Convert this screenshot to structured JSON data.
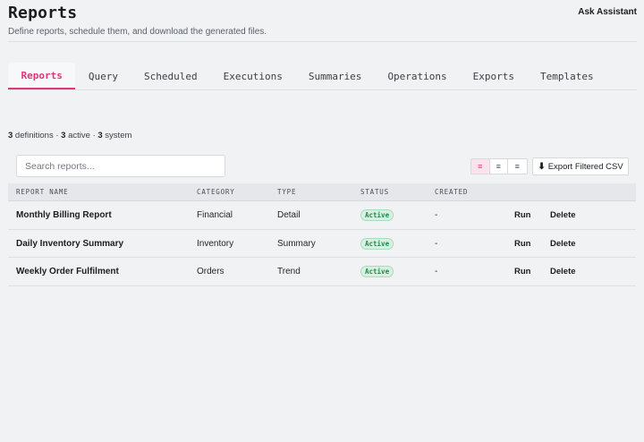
{
  "header": {
    "title": "Reports",
    "subtitle": "Define reports, schedule them, and download the generated files.",
    "assistant_label": "Ask Assistant"
  },
  "tabs": [
    {
      "label": "Reports",
      "active": true
    },
    {
      "label": "Query",
      "active": false
    },
    {
      "label": "Scheduled",
      "active": false
    },
    {
      "label": "Executions",
      "active": false
    },
    {
      "label": "Summaries",
      "active": false
    },
    {
      "label": "Operations",
      "active": false
    },
    {
      "label": "Exports",
      "active": false
    },
    {
      "label": "Templates",
      "active": false
    }
  ],
  "counts": {
    "definitions_num": "3",
    "definitions_label": " definitions · ",
    "active_num": "3",
    "active_label": " active · ",
    "system_num": "3",
    "system_label": " system"
  },
  "search": {
    "placeholder": "Search reports...",
    "value": ""
  },
  "density": {
    "icon": "≡",
    "selected": "compact"
  },
  "export": {
    "icon": "⬇",
    "label": "Export Filtered CSV"
  },
  "table": {
    "columns": [
      "REPORT NAME",
      "CATEGORY",
      "TYPE",
      "STATUS",
      "CREATED"
    ],
    "rows": [
      {
        "name": "Monthly Billing Report",
        "category": "Financial",
        "type": "Detail",
        "status": "Active",
        "created": "-",
        "run": "Run",
        "delete": "Delete"
      },
      {
        "name": "Daily Inventory Summary",
        "category": "Inventory",
        "type": "Summary",
        "status": "Active",
        "created": "-",
        "run": "Run",
        "delete": "Delete"
      },
      {
        "name": "Weekly Order Fulfilment",
        "category": "Orders",
        "type": "Trend",
        "status": "Active",
        "created": "-",
        "run": "Run",
        "delete": "Delete"
      }
    ]
  },
  "colors": {
    "accent": "#e0357c",
    "status_active_text": "#1f8a4c",
    "status_active_bg": "#d7f0df"
  }
}
